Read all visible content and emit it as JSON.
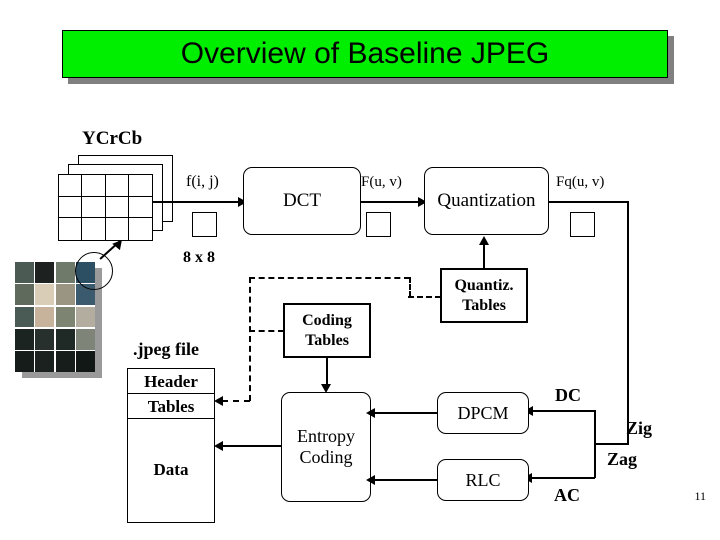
{
  "slide": {
    "title": "Overview of Baseline JPEG",
    "page_number": "11",
    "title_bg_color": "#00ee00",
    "title_shadow_color": "#808080"
  },
  "input": {
    "colorspace_label": "YCrCb",
    "signal_label": "f(i, j)",
    "block_size_label": "8 x 8"
  },
  "pipeline": {
    "dct": "DCT",
    "quantization": "Quantization",
    "entropy_coding_line1": "Entropy",
    "entropy_coding_line2": "Coding",
    "dpcm": "DPCM",
    "rlc": "RLC"
  },
  "signals": {
    "dct_output": "F(u, v)",
    "quant_output": "Fq(u, v)",
    "dc": "DC",
    "ac": "AC",
    "zig": "Zig",
    "zag": "Zag"
  },
  "tables": {
    "quantiz_line1": "Quantiz.",
    "quantiz_line2": "Tables",
    "coding_line1": "Coding",
    "coding_line2": "Tables"
  },
  "file": {
    "caption": ".jpeg file",
    "header": "Header",
    "tables": "Tables",
    "data": "Data"
  },
  "photo_mosaic": {
    "rows": 5,
    "cols": 4,
    "tiles": [
      "#4b5a52",
      "#1d2220",
      "#6f7a6a",
      "#2c4f63",
      "#5f6a5d",
      "#d9cdb7",
      "#9a9582",
      "#3c5a6d",
      "#4a5b56",
      "#c7b39c",
      "#7e8472",
      "#b3ada0",
      "#1b2420",
      "#27302c",
      "#1f2926",
      "#7f8478",
      "#151c1a",
      "#1a211e",
      "#161d1b",
      "#121816"
    ]
  }
}
